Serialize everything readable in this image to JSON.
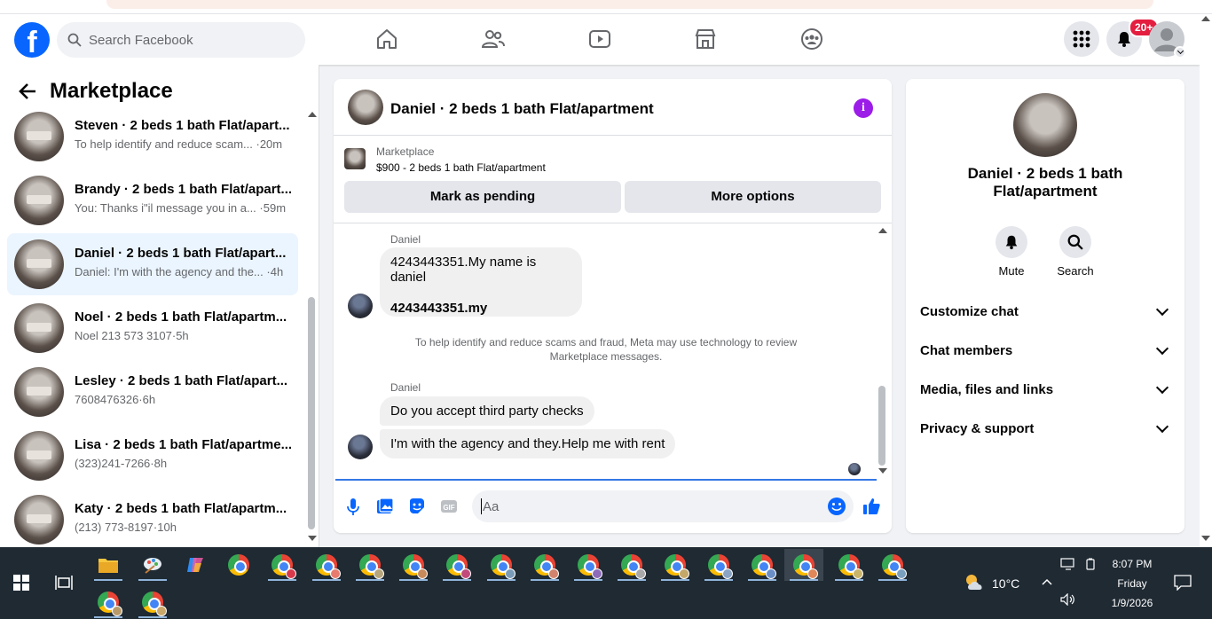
{
  "nav": {
    "search_placeholder": "Search Facebook",
    "notifications_badge": "20+",
    "icons": [
      "home-icon",
      "friends-icon",
      "watch-icon",
      "marketplace-icon",
      "groups-icon"
    ]
  },
  "left_panel": {
    "title": "Marketplace",
    "conversations": [
      {
        "name": "Steven · 2 beds 1 bath Flat/apart...",
        "snippet": "To help identify and reduce scam... ·20m"
      },
      {
        "name": "Brandy · 2 beds 1 bath Flat/apart...",
        "snippet": "You: Thanks i\"il message you in a... ·59m"
      },
      {
        "name": "Daniel · 2 beds 1 bath Flat/apart...",
        "snippet": "Daniel: I'm with the agency and the... ·4h"
      },
      {
        "name": "Noel · 2 beds 1 bath Flat/apartm...",
        "snippet": "Noel 213 573 3107·5h"
      },
      {
        "name": "Lesley · 2 beds 1 bath Flat/apart...",
        "snippet": "7608476326·6h"
      },
      {
        "name": "Lisa · 2 beds 1 bath Flat/apartme...",
        "snippet": "(323)241-7266·8h"
      },
      {
        "name": "Katy · 2 beds 1 bath Flat/apartm...",
        "snippet": "(213) 773-8197·10h"
      }
    ]
  },
  "chat": {
    "title": "Daniel · 2 beds 1 bath Flat/apartment",
    "marketplace_label": "Marketplace",
    "item": "$900 - 2 beds 1 bath Flat/apartment",
    "mark_pending": "Mark as pending",
    "more_options": "More options",
    "sender1": "Daniel",
    "msg1_line1": "4243443351.My name is daniel",
    "msg1_line2": "4243443351.my",
    "notice": "To help identify and reduce scams and fraud, Meta may use technology to review Marketplace messages.",
    "sender2": "Daniel",
    "msg2": "Do you accept third party checks",
    "msg3": "I'm with the agency and they.Help me with rent",
    "composer_placeholder": "Aa"
  },
  "right_panel": {
    "title": "Daniel · 2 beds 1 bath Flat/apartment",
    "mute": "Mute",
    "search": "Search",
    "rows": [
      "Customize chat",
      "Chat members",
      "Media, files and links",
      "Privacy & support"
    ]
  },
  "taskbar": {
    "temperature": "10°C",
    "time": "8:07 PM",
    "day": "Friday",
    "date": "1/9/2026"
  },
  "colors": {
    "brand": "#0866ff",
    "info": "#9c1ce8",
    "badge": "#e41e3f"
  }
}
